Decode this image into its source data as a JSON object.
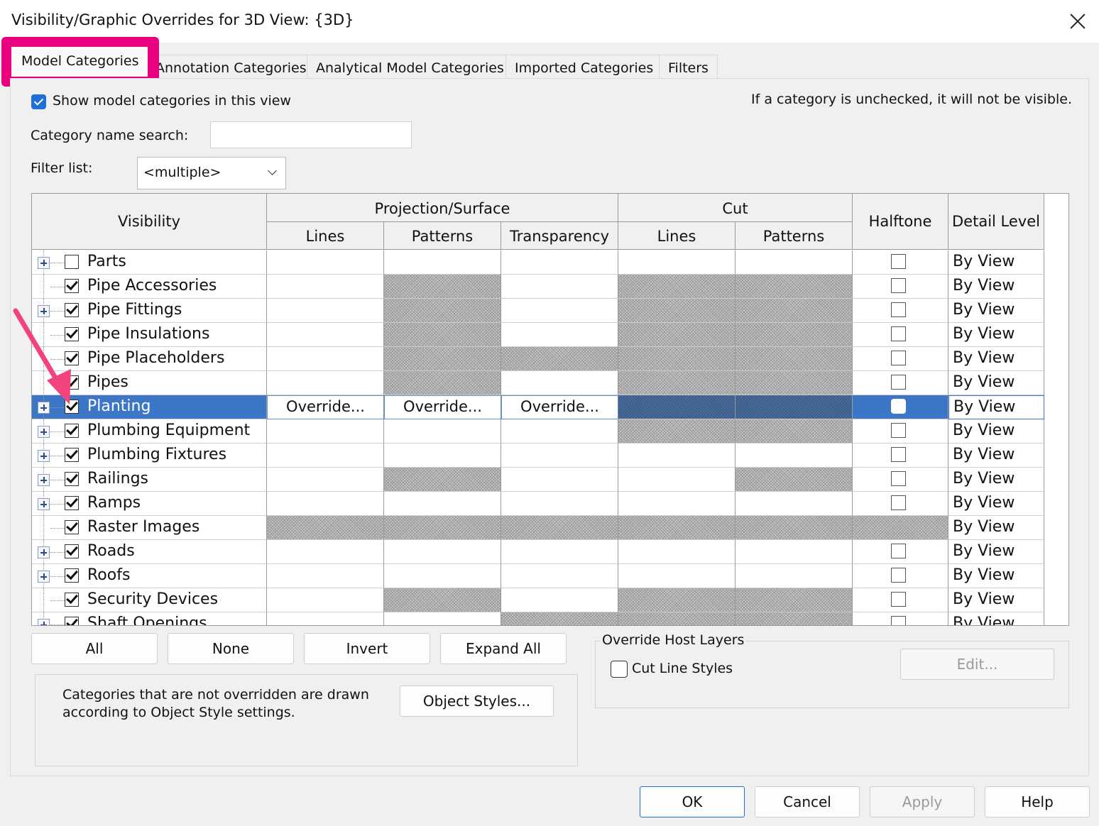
{
  "window": {
    "title": "Visibility/Graphic Overrides for 3D View: {3D}"
  },
  "tabs": [
    "Model Categories",
    "Annotation Categories",
    "Analytical Model Categories",
    "Imported Categories",
    "Filters"
  ],
  "show_categories": {
    "label": "Show model categories in this view",
    "checked": true
  },
  "hint": "If a category is unchecked, it will not be visible.",
  "search": {
    "label": "Category name search:",
    "value": ""
  },
  "filter": {
    "label": "Filter list:",
    "value": "<multiple>"
  },
  "table": {
    "headers": {
      "visibility": "Visibility",
      "projection": "Projection/Surface",
      "cut": "Cut",
      "lines": "Lines",
      "patterns": "Patterns",
      "transparency": "Transparency",
      "cut_lines": "Lines",
      "cut_patterns": "Patterns",
      "halftone": "Halftone",
      "detail": "Detail Level"
    },
    "override_label": "Override...",
    "rows": [
      {
        "name": "Parts",
        "checked": false,
        "expandable": true,
        "hatch": [],
        "halftone": true,
        "detail": "By View"
      },
      {
        "name": "Pipe Accessories",
        "checked": true,
        "expandable": false,
        "hatch": [
          1,
          3,
          4
        ],
        "halftone": true,
        "detail": "By View"
      },
      {
        "name": "Pipe Fittings",
        "checked": true,
        "expandable": true,
        "hatch": [
          1,
          3,
          4
        ],
        "halftone": true,
        "detail": "By View"
      },
      {
        "name": "Pipe Insulations",
        "checked": true,
        "expandable": false,
        "hatch": [
          1,
          3,
          4
        ],
        "halftone": true,
        "detail": "By View"
      },
      {
        "name": "Pipe Placeholders",
        "checked": true,
        "expandable": false,
        "hatch": [
          1,
          2,
          3,
          4
        ],
        "halftone": true,
        "detail": "By View"
      },
      {
        "name": "Pipes",
        "checked": true,
        "expandable": false,
        "hatch": [
          1,
          3,
          4
        ],
        "halftone": true,
        "detail": "By View"
      },
      {
        "name": "Planting",
        "checked": true,
        "expandable": true,
        "hatch": [
          3,
          4
        ],
        "halftone": true,
        "detail": "By View",
        "selected": true
      },
      {
        "name": "Plumbing Equipment",
        "checked": true,
        "expandable": true,
        "hatch": [
          3,
          4
        ],
        "halftone": true,
        "detail": "By View"
      },
      {
        "name": "Plumbing Fixtures",
        "checked": true,
        "expandable": true,
        "hatch": [],
        "halftone": true,
        "detail": "By View"
      },
      {
        "name": "Railings",
        "checked": true,
        "expandable": true,
        "hatch": [
          1,
          4
        ],
        "halftone": true,
        "detail": "By View"
      },
      {
        "name": "Ramps",
        "checked": true,
        "expandable": true,
        "hatch": [],
        "halftone": true,
        "detail": "By View"
      },
      {
        "name": "Raster Images",
        "checked": true,
        "expandable": false,
        "hatch": [
          0,
          1,
          2,
          3,
          4,
          5
        ],
        "halftone": false,
        "detail": "By View"
      },
      {
        "name": "Roads",
        "checked": true,
        "expandable": true,
        "hatch": [],
        "halftone": true,
        "detail": "By View"
      },
      {
        "name": "Roofs",
        "checked": true,
        "expandable": true,
        "hatch": [],
        "halftone": true,
        "detail": "By View"
      },
      {
        "name": "Security Devices",
        "checked": true,
        "expandable": false,
        "hatch": [
          1,
          3,
          4
        ],
        "halftone": true,
        "detail": "By View"
      },
      {
        "name": "Shaft Openings",
        "checked": true,
        "expandable": true,
        "hatch": [
          2,
          3,
          4
        ],
        "halftone": true,
        "detail": "By View"
      }
    ]
  },
  "buttons": {
    "all": "All",
    "none": "None",
    "invert": "Invert",
    "expand_all": "Expand All"
  },
  "note": "Categories that are not overridden are drawn according to Object Style settings.",
  "object_styles": "Object Styles...",
  "override_host": {
    "title": "Override Host Layers",
    "cut_line_styles": "Cut Line Styles",
    "edit": "Edit..."
  },
  "footer": {
    "ok": "OK",
    "cancel": "Cancel",
    "apply": "Apply",
    "help": "Help"
  },
  "colors": {
    "highlight": "#e9007f",
    "selection": "#3b77c6",
    "accent": "#1f6fd6"
  }
}
